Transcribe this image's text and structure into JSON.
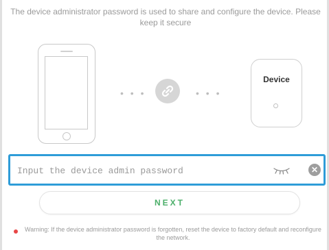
{
  "intro_text": "The device administrator password is used to share and configure the device. Please keep it secure",
  "illustration": {
    "device_label": "Device",
    "dots_left": "• • •",
    "dots_right": "• • •",
    "link_icon": "link-icon",
    "phone_icon": "phone-illustration"
  },
  "password_field": {
    "placeholder": "Input the device admin password",
    "value": "",
    "visibility_icon": "eye-closed-icon",
    "clear_icon": "clear-icon",
    "accent_color": "#2e9cd8"
  },
  "next_button": {
    "label": "NEXT",
    "color": "#4caf6a"
  },
  "warning": {
    "text": "Warning: If the device administrator password is forgotten, reset the device to factory default and reconfigure the network.",
    "dot_color": "#e84646"
  }
}
